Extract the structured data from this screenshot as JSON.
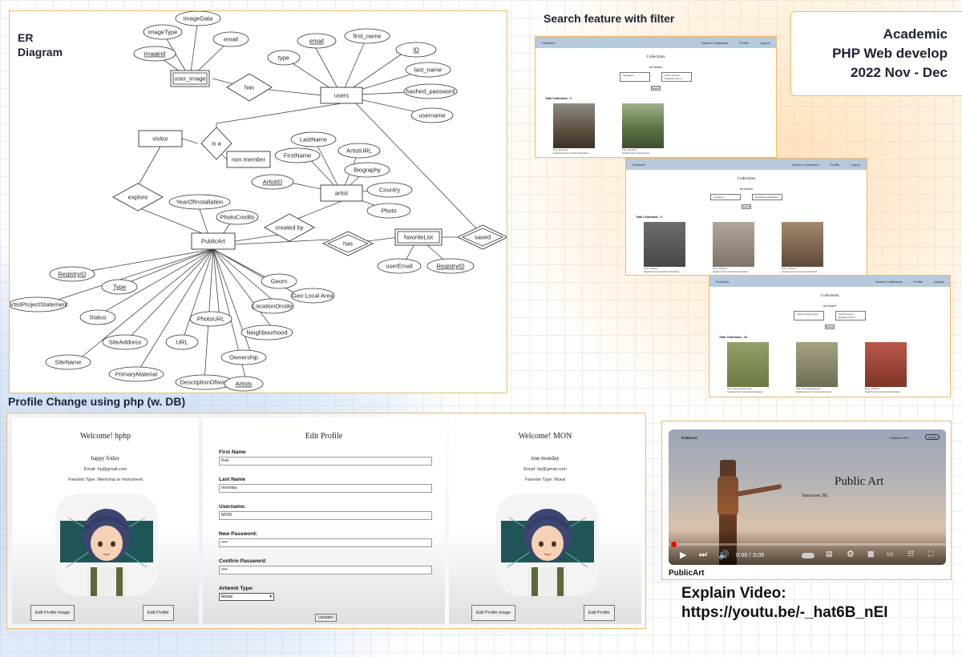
{
  "er": {
    "title_line1": "ER",
    "title_line2": "Diagram",
    "entities": [
      "user_image",
      "users",
      "visitor",
      "non member",
      "artist",
      "PublicArt",
      "favoriteList"
    ],
    "relationships": [
      "has",
      "is a",
      "explore",
      "created by",
      "has",
      "saved"
    ],
    "attributes": {
      "user_image": [
        "imageData",
        "imageType",
        "email",
        "imageId"
      ],
      "users": [
        "email",
        "first_name",
        "ID",
        "last_name",
        "hashed_password",
        "username",
        "type"
      ],
      "artist": [
        "LastName",
        "FirstName",
        "ArtistURL",
        "Biography",
        "ArtistID",
        "Country",
        "Photo"
      ],
      "PublicArt": [
        "YearOfInstallation",
        "PhotoCredits",
        "RegistryID",
        "ArtistProjectStatement",
        "Type",
        "Status",
        "SiteAddress",
        "SiteName",
        "PrimaryMaterial",
        "URL",
        "DescriptionOfwork",
        "PhotoURL",
        "Neighbourhood",
        "Ownership",
        "Artists",
        "LocationOnsite",
        "Geom",
        "Geo Local Area"
      ],
      "favoriteList": [
        "userEmail",
        "RegistryID"
      ]
    }
  },
  "search": {
    "heading": "Search feature with filter",
    "shots": [
      {
        "brand": "PublicArt",
        "nav": [
          "Search Collections",
          "Profile",
          "Logout"
        ],
        "title": "Collections",
        "sub": "Art Search",
        "sel1": "Figurative",
        "sel2": "Select Area of Neighbourhood",
        "btn": "Search",
        "total": "Total Collections : 2",
        "cards": [
          {
            "cap1": "Type: Figurative",
            "cap2": "Neighbourhood: Grandview Woodland",
            "color": "#6a5a44"
          },
          {
            "cap1": "Type: Figurative",
            "cap2": "Neighbourhood: Stanley Park",
            "color": "#4d6a3a"
          }
        ]
      },
      {
        "brand": "PublicArt",
        "nav": [
          "Search Collections",
          "Profile",
          "Logout"
        ],
        "title": "Collections",
        "sub": "Art Search",
        "sel1": "Sculpture",
        "sel2": "Grandview-Woodland",
        "btn": "Search",
        "total": "Total Collections : 3",
        "cards": [
          {
            "cap1": "Type: Sculpture",
            "cap2": "Neighbourhood: Grandview-Woodland",
            "color": "#55585a"
          },
          {
            "cap1": "Type: Sculpture",
            "cap2": "Neighbourhood: Grandview-Woodland",
            "color": "#8c8378"
          },
          {
            "cap1": "Type: Sculpture",
            "cap2": "Neighbourhood: Grandview-Woodland",
            "color": "#7a6450"
          }
        ]
      },
      {
        "brand": "PublicArt",
        "nav": [
          "Search Collections",
          "Profile",
          "Logout"
        ],
        "title": "Collections",
        "sub": "Art Search",
        "sel1": "Select Artwork Type",
        "sel2": "Select Area of Neighbourhood",
        "btn": "Search",
        "total": "Total Collections : 43",
        "cards": [
          {
            "cap1": "Type: Site-integrated work",
            "cap2": "Neighbourhood: Grandview-Woodland",
            "color": "#7c8a55"
          },
          {
            "cap1": "Type: Site-integrated work",
            "cap2": "Neighbourhood: Grandview-Woodland",
            "color": "#8e8a6a"
          },
          {
            "cap1": "Type: Sculpture",
            "cap2": "Neighbourhood: Grandview-Woodland",
            "color": "#a14a3a"
          }
        ]
      }
    ]
  },
  "academic": {
    "line1": "Academic",
    "line2": "PHP Web develop",
    "line3": "2022 Nov - Dec"
  },
  "profile": {
    "heading": "Profile Change using php (w. DB)",
    "left": {
      "welcome": "Welcome! hphp",
      "name": "happy friday",
      "email": "Email: hp@gmail.com",
      "fav": "Favorite Type: Memorial or monument",
      "btn1": "Edit Profile image",
      "btn2": "Edit Profile"
    },
    "edit": {
      "title": "Edit Profile",
      "fields": [
        {
          "label": "First Name",
          "value": "true"
        },
        {
          "label": "Last Name",
          "value": "monday"
        },
        {
          "label": "Username:",
          "value": "MON"
        },
        {
          "label": "New Password:",
          "value": "••••"
        },
        {
          "label": "Confirm Password:",
          "value": "••••"
        }
      ],
      "type_label": "Artwork Type:",
      "type_value": "Mural",
      "submit": "Update!"
    },
    "right": {
      "welcome": "Welcome! MON",
      "name": "true monday",
      "email": "Email: hp@gmail.com",
      "fav": "Favorite Type: Mural",
      "btn1": "Edit Profile image",
      "btn2": "Edit Profile"
    }
  },
  "video": {
    "brand": "PublicArt",
    "nav": "PublicArt ☰ ▾",
    "login": "Login",
    "title": "Public Art",
    "location": "Vancouver, BC",
    "time": "0:00 / 3:05",
    "caption": "PublicArt",
    "explain_label": "Explain Video:",
    "url": "https://youtu.be/-_hat6B_nEI",
    "progress": 0.0
  }
}
